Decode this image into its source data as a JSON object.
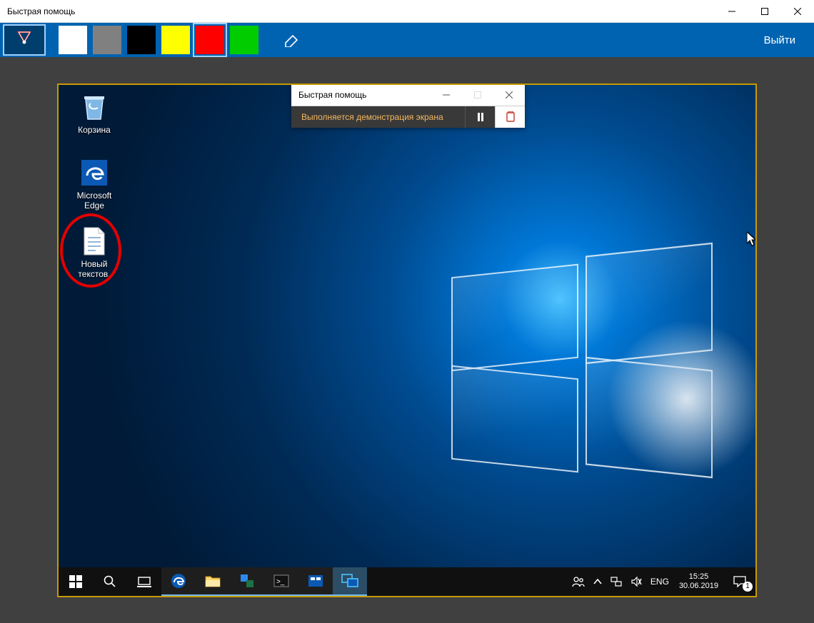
{
  "window": {
    "title": "Быстрая помощь"
  },
  "toolbar": {
    "colors": {
      "white": "#ffffff",
      "gray": "#808080",
      "black": "#000000",
      "yellow": "#ffff00",
      "red": "#ff0000",
      "green": "#00cc00"
    },
    "exit_label": "Выйти"
  },
  "remote": {
    "desktop_icons": {
      "recycle_bin": "Корзина",
      "edge": "Microsoft Edge",
      "textfile": "Новый текстов."
    }
  },
  "mini_window": {
    "title": "Быстрая помощь",
    "status": "Выполняется демонстрация экрана"
  },
  "taskbar": {
    "lang": "ENG",
    "time": "15:25",
    "date": "30.06.2019",
    "notif_count": "1"
  }
}
